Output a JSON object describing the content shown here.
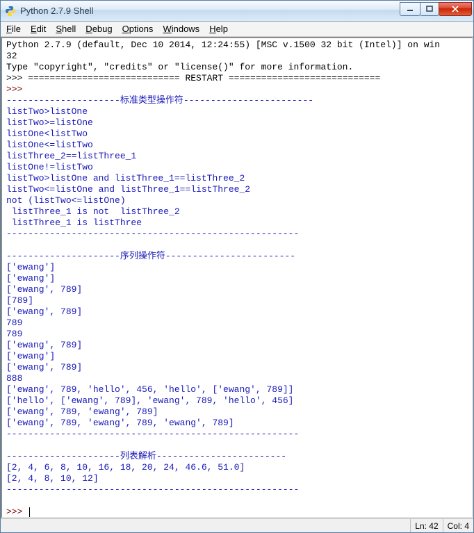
{
  "window": {
    "title": "Python 2.7.9 Shell"
  },
  "menu": {
    "file": "File",
    "edit": "Edit",
    "shell": "Shell",
    "debug": "Debug",
    "options": "Options",
    "windows": "Windows",
    "help": "Help"
  },
  "header": {
    "line1": "Python 2.7.9 (default, Dec 10 2014, 12:24:55) [MSC v.1500 32 bit (Intel)] on win",
    "line2": "32",
    "line3": "Type \"copyright\", \"credits\" or \"license()\" for more information.",
    "restart_line": ">>> ============================ RESTART ============================"
  },
  "prompt": ">>> ",
  "sections": {
    "std_type": "---------------------标准类型操作符------------------------",
    "seq": "---------------------序列操作符------------------------",
    "list_comp": "---------------------列表解析------------------------",
    "hr": "------------------------------------------------------"
  },
  "lines": {
    "a0": "listTwo>listOne",
    "a1": "listTwo>=listOne",
    "a2": "listOne<listTwo",
    "a3": "listOne<=listTwo",
    "a4": "listThree_2==listThree_1",
    "a5": "listOne!=listTwo",
    "a6": "listTwo>listOne and listThree_1==listThree_2",
    "a7": "listTwo<=listOne and listThree_1==listThree_2",
    "a8": "not (listTwo<=listOne)",
    "a9": " listThree_1 is not  listThree_2",
    "a10": " listThree_1 is listThree",
    "b0": "['ewang']",
    "b1": "['ewang']",
    "b2": "['ewang', 789]",
    "b3": "[789]",
    "b4": "['ewang', 789]",
    "b5": "789",
    "b6": "789",
    "b7": "['ewang', 789]",
    "b8": "['ewang']",
    "b9": "['ewang', 789]",
    "b10": "888",
    "b11": "['ewang', 789, 'hello', 456, 'hello', ['ewang', 789]]",
    "b12": "['hello', ['ewang', 789], 'ewang', 789, 'hello', 456]",
    "b13": "['ewang', 789, 'ewang', 789]",
    "b14": "['ewang', 789, 'ewang', 789, 'ewang', 789]",
    "c0": "[2, 4, 6, 8, 10, 16, 18, 20, 24, 46.6, 51.0]",
    "c1": "[2, 4, 8, 10, 12]"
  },
  "status": {
    "ln": "Ln: 42",
    "col": "Col: 4"
  }
}
